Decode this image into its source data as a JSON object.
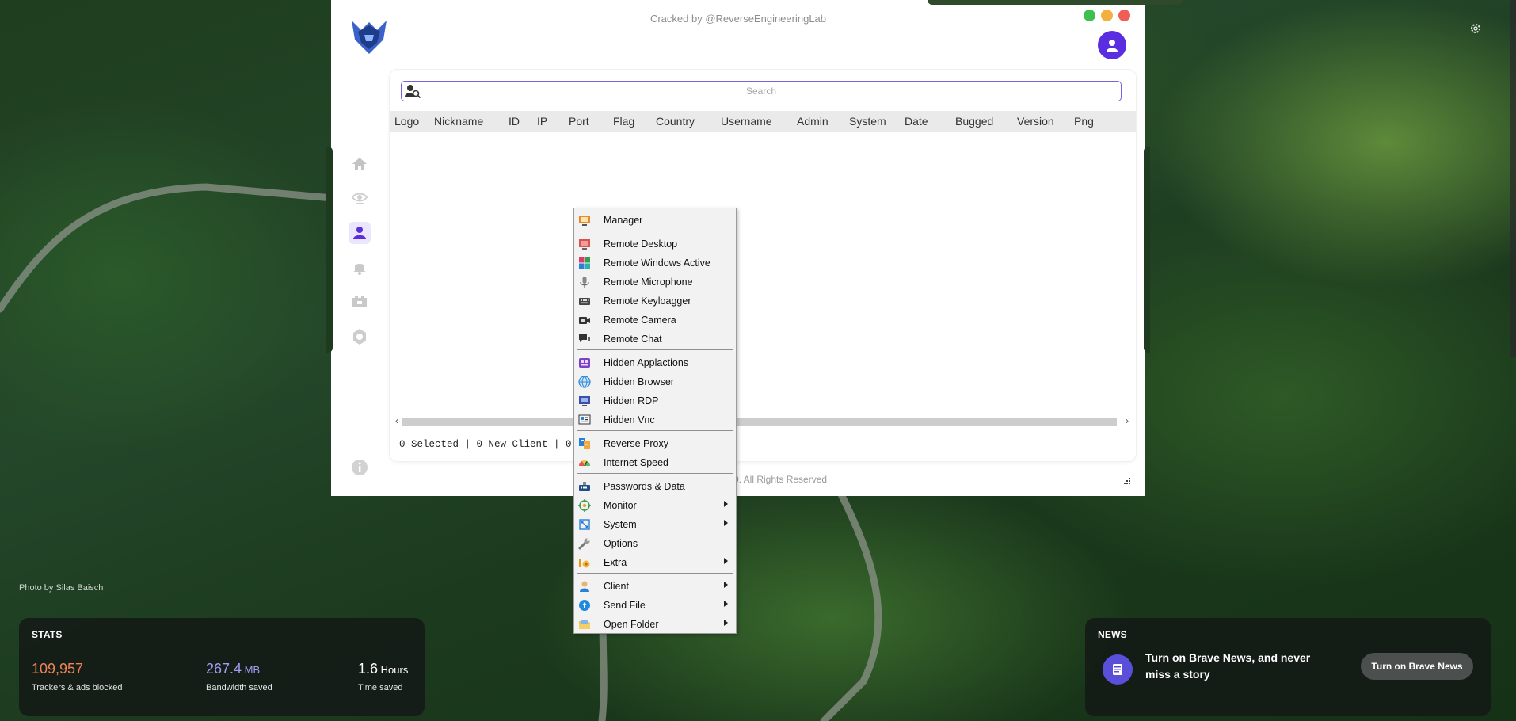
{
  "app": {
    "title": "Cracked by @ReverseEngineeringLab",
    "search_placeholder": "Search",
    "columns": [
      "Logo",
      "Nickname",
      "ID",
      "IP",
      "Port",
      "Flag",
      "Country",
      "Username",
      "Admin",
      "System",
      "Date",
      "Bugged",
      "Version",
      "Png"
    ],
    "status": "0 Selected | 0 New Client | 0 C",
    "copyright": "0. All Rights Reserved",
    "sidebar": [
      "home-icon",
      "eye-icon",
      "user-icon",
      "bell-icon",
      "plugin-icon",
      "settings-icon"
    ]
  },
  "context_menu": {
    "groups": [
      [
        {
          "label": "Manager",
          "icon": "manager-icon",
          "submenu": false
        }
      ],
      [
        {
          "label": "Remote Desktop",
          "icon": "desktop-icon",
          "submenu": false
        },
        {
          "label": "Remote Windows Active",
          "icon": "windows-icon",
          "submenu": false
        },
        {
          "label": "Remote Microphone",
          "icon": "microphone-icon",
          "submenu": false
        },
        {
          "label": "Remote Keyloagger",
          "icon": "keyboard-icon",
          "submenu": false
        },
        {
          "label": "Remote Camera",
          "icon": "camera-icon",
          "submenu": false
        },
        {
          "label": "Remote Chat",
          "icon": "chat-icon",
          "submenu": false
        }
      ],
      [
        {
          "label": "Hidden Applactions",
          "icon": "apps-icon",
          "submenu": false
        },
        {
          "label": "Hidden Browser",
          "icon": "globe-icon",
          "submenu": false
        },
        {
          "label": "Hidden RDP",
          "icon": "rdp-icon",
          "submenu": false
        },
        {
          "label": "Hidden Vnc",
          "icon": "vnc-icon",
          "submenu": false
        }
      ],
      [
        {
          "label": "Reverse Proxy",
          "icon": "proxy-icon",
          "submenu": false
        },
        {
          "label": "Internet Speed",
          "icon": "speed-icon",
          "submenu": false
        }
      ],
      [
        {
          "label": "Passwords & Data",
          "icon": "passwords-icon",
          "submenu": false
        },
        {
          "label": "Monitor",
          "icon": "monitor-icon",
          "submenu": true
        },
        {
          "label": "System",
          "icon": "system-icon",
          "submenu": true
        },
        {
          "label": "Options",
          "icon": "wrench-icon",
          "submenu": false
        },
        {
          "label": "Extra",
          "icon": "extra-icon",
          "submenu": true
        }
      ],
      [
        {
          "label": "Client",
          "icon": "client-icon",
          "submenu": true
        },
        {
          "label": "Send File",
          "icon": "send-file-icon",
          "submenu": true
        },
        {
          "label": "Open Folder",
          "icon": "folder-icon",
          "submenu": true
        }
      ]
    ]
  },
  "ntp": {
    "photo_credit": "Photo by Silas Baisch",
    "stats_title": "STATS",
    "stats": [
      {
        "value": "109,957",
        "unit": "",
        "label": "Trackers & ads blocked",
        "color": "#f0825a"
      },
      {
        "value": "267.4",
        "unit": " MB",
        "label": "Bandwidth saved",
        "color": "#a79bf5"
      },
      {
        "value": "1.6",
        "unit": " Hours",
        "label": "Time saved",
        "color": "#ffffff"
      }
    ],
    "news_title": "NEWS",
    "news_text": "Turn on Brave News, and never miss a story",
    "news_button": "Turn on Brave News"
  }
}
